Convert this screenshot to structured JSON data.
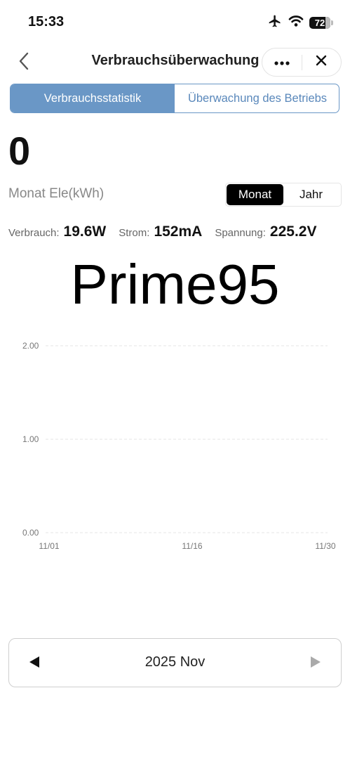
{
  "status_bar": {
    "time": "15:33",
    "battery": "72",
    "icons": [
      "airplane-icon",
      "wifi-icon",
      "battery-icon"
    ]
  },
  "nav": {
    "title": "Verbrauchsüberwachung",
    "back_icon": "chevron-left-icon",
    "more_icon": "more-dots-icon",
    "close_icon": "close-icon"
  },
  "tabs": [
    {
      "label": "Verbrauchsstatistik",
      "active": true
    },
    {
      "label": "Überwachung des Betriebs",
      "active": false
    }
  ],
  "summary": {
    "value": "0",
    "unit_label": "Monat Ele(kWh)"
  },
  "period_toggle": {
    "options": [
      {
        "label": "Monat",
        "active": true
      },
      {
        "label": "Jahr",
        "active": false
      }
    ]
  },
  "metrics": [
    {
      "label": "Verbrauch:",
      "value": "19.6W"
    },
    {
      "label": "Strom:",
      "value": "152mA"
    },
    {
      "label": "Spannung:",
      "value": "225.2V"
    }
  ],
  "device_name": "Prime95",
  "chart_data": {
    "type": "line",
    "title": "",
    "xlabel": "",
    "ylabel": "",
    "ylim": [
      0,
      2
    ],
    "y_ticks": [
      "0.00",
      "1.00",
      "2.00"
    ],
    "x_tick_labels": [
      "11/01",
      "11/16",
      "11/30"
    ],
    "grid": true,
    "series": []
  },
  "month_nav": {
    "label": "2025 Nov",
    "prev_icon": "triangle-left-icon",
    "next_icon": "triangle-right-icon"
  },
  "colors": {
    "accent": "#6a97c6",
    "toggle_active": "#000000",
    "grid": "#e6e6e6",
    "axis_text": "#777777",
    "disabled": "#aaaaaa"
  }
}
